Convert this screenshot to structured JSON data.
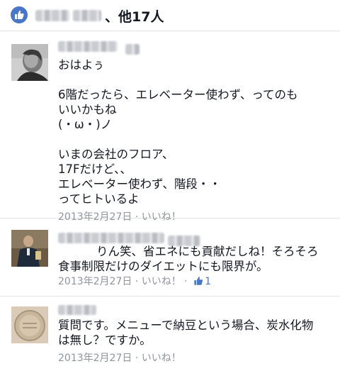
{
  "likes": {
    "suffix": "、他17人",
    "colors": {
      "accent": "#4a76c8"
    },
    "icon": "thumbs-up-icon"
  },
  "comments": [
    {
      "text": "おはよぅ\n\n6階だったら、エレベーター使わず、ってのも\nいいかもね\n(・ω・)ノ\n\nいまの会社のフロア、\n17Fだけど、、\nエレベーター使わず、階段・・\nってヒトいるよ",
      "date": "2013年2月27日",
      "separator": " · ",
      "like_label": "いいね！"
    },
    {
      "text": "りん笑、省エネにも貢献だしね！そろそろ\n食事制限だけのダイエットにも限界が。",
      "date": "2013年2月27日",
      "separator": " · ",
      "like_label": "いいね！",
      "second_separator": " · ",
      "like_count": "1"
    },
    {
      "text": "質問です。メニューで納豆という場合、炭水化物\nは無し？ですか。",
      "date": "2013年2月27日",
      "separator": " · ",
      "like_label": "いいね！"
    }
  ]
}
